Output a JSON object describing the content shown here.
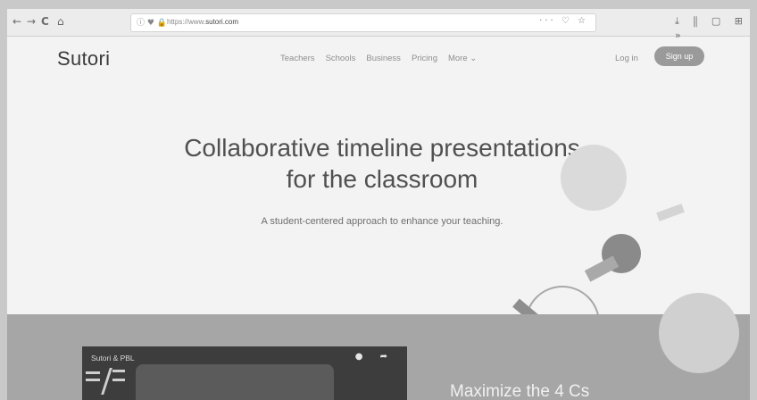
{
  "browser": {
    "back_icon": "←",
    "forward_icon": "→",
    "reload_icon": "C",
    "home_icon": "⌂",
    "url_icons": "ⓘ ♥ 🔒",
    "url_prefix": "https://www.",
    "url_domain": "sutori.com",
    "page_actions": "··· ♡ ☆",
    "toolbar_right": "⤓ ⫼ ▢ ⊞ »"
  },
  "site": {
    "logo": "Sutori",
    "nav": {
      "teachers": "Teachers",
      "schools": "Schools",
      "business": "Business",
      "pricing": "Pricing",
      "more": "More ⌄"
    },
    "login": "Log in",
    "signup": "Sign up"
  },
  "hero": {
    "title_line1": "Collaborative timeline presentations",
    "title_line2": "for the classroom",
    "subtitle": "A student-centered approach to enhance your teaching."
  },
  "video": {
    "title": "Sutori & PBL",
    "controls": "● ➦"
  },
  "section": {
    "heading": "Maximize the 4 Cs"
  }
}
